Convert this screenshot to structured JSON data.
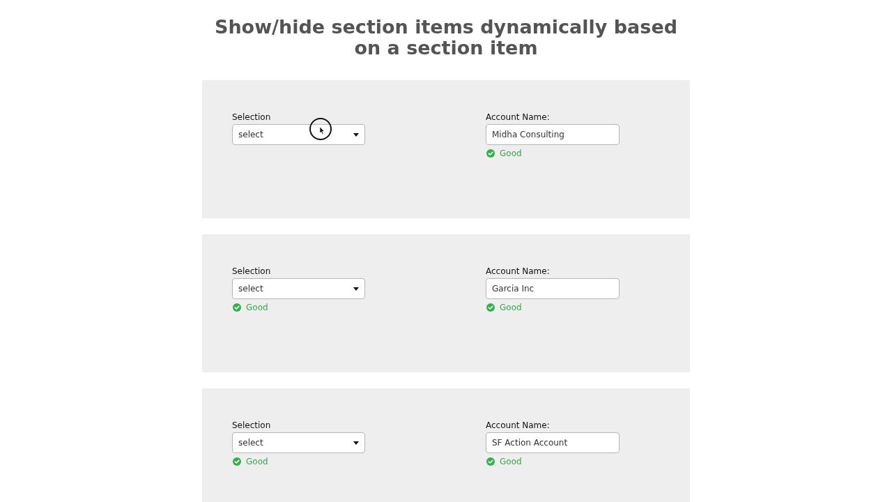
{
  "title": "Show/hide section items dynamically based on a section item",
  "sections": [
    {
      "fields": [
        {
          "kind": "dropdown",
          "label": "Selection",
          "value": "select"
        },
        {
          "kind": "text",
          "label": "Account Name:",
          "value": "Midha Consulting",
          "message": "Good"
        }
      ]
    },
    {
      "fields": [
        {
          "kind": "dropdown",
          "label": "Selection",
          "value": "select",
          "message": "Good"
        },
        {
          "kind": "text",
          "label": "Account Name:",
          "value": "Garcia Inc",
          "message": "Good"
        }
      ]
    },
    {
      "fields": [
        {
          "kind": "dropdown",
          "label": "Selection",
          "value": "select",
          "message": "Good"
        },
        {
          "kind": "text",
          "label": "Account Name:",
          "value": "SF Action Account",
          "message": "Good"
        }
      ]
    }
  ]
}
